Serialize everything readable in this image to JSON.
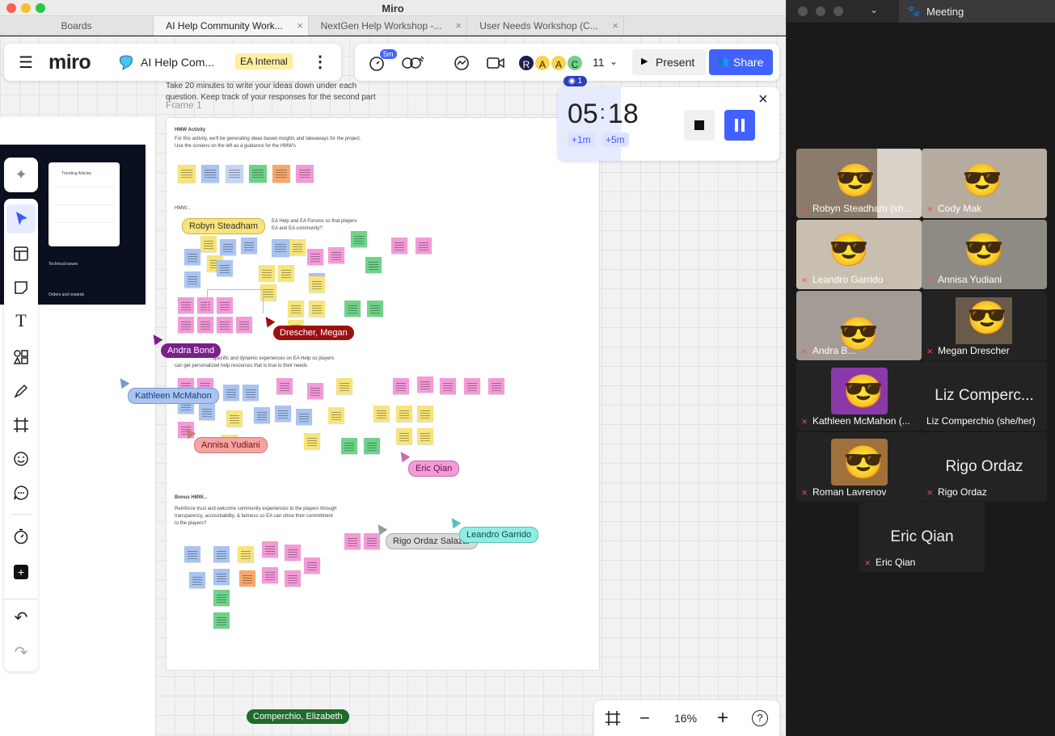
{
  "window": {
    "title": "Miro"
  },
  "tabs": [
    {
      "label": "Boards"
    },
    {
      "label": "AI Help Community Work...",
      "close": "×"
    },
    {
      "label": "NextGen Help Workshop -...",
      "close": "×"
    },
    {
      "label": "User Needs Workshop (C...",
      "close": "×"
    }
  ],
  "toolbar": {
    "menu_icon": "hamburger-icon",
    "logo": "miro",
    "board_name": "AI Help Com...",
    "badge": "EA Internal",
    "more": "⋮",
    "timer_badge": "5m",
    "avatars": [
      "R",
      "A",
      "A",
      "C"
    ],
    "avatar_count": "11",
    "present_label": "Present",
    "share_label": "Share",
    "viewers_count": "1"
  },
  "timer": {
    "minutes": "05",
    "seconds": "18",
    "separator": ":",
    "add1": "+1m",
    "add5": "+5m",
    "close": "×"
  },
  "frame": {
    "label": "Frame 1",
    "intro_line1": "Take 20 minutes to write your ideas down under each",
    "intro_line2": "question. Keep track of your responses for the second part",
    "hmw_title": "HMW Activity",
    "hmw_desc1": "For this activity, we'll be generating ideas based insights and takeaways for the project.",
    "hmw_desc2": "Use the screens on the left as a guidance for the HMW's",
    "q1_label": "HMW...",
    "q1_line1": "EA Help and EA Forums  so that players",
    "q1_line2": "EA and EA community?",
    "q2_line1": "...specific and dynamic experiences on EA Help so players",
    "q2_line2": "can get personalized help resources that is true to their needs",
    "bonus_title": "Bonus HMW...",
    "bonus_line1": "Reinforce trust and welcome community experiences to the players through",
    "bonus_line2": "transparency, accountability, & fairness so EA can show their commitment",
    "bonus_line3": "to the players?"
  },
  "screen_preview": {
    "heading": "Trending Articles",
    "section1": "Technical issues",
    "section2": "Orders and rewards"
  },
  "cursors": [
    {
      "name": "Robyn Steadham",
      "color": "#f7e47a",
      "text": "#333"
    },
    {
      "name": "Drescher, Megan",
      "color": "#9b1111",
      "text": "#fff"
    },
    {
      "name": "Andra Bond",
      "color": "#7b1f8a",
      "text": "#fff"
    },
    {
      "name": "Kathleen McMahon",
      "color": "#a9c4f0",
      "text": "#1a3a7a"
    },
    {
      "name": "Annisa Yudiani",
      "color": "#f5a3a3",
      "text": "#6b1212"
    },
    {
      "name": "Eric Qian",
      "color": "#f39ad8",
      "text": "#6a0f4e"
    },
    {
      "name": "Rigo Ordaz Salazar",
      "color": "#d9d9d9",
      "text": "#333"
    },
    {
      "name": "Leandro Garrido",
      "color": "#8eeee6",
      "text": "#0d4d47"
    },
    {
      "name": "Comperchio, Elizabeth",
      "color": "#1f6b2a",
      "text": "#fff"
    }
  ],
  "zoom": {
    "level": "16%",
    "minus": "−",
    "plus": "+",
    "help": "?"
  },
  "meeting": {
    "title": "Meeting",
    "participants": [
      {
        "name": "Robyn Steadham (sh...",
        "muted": true
      },
      {
        "name": "Cody Mak",
        "muted": true
      },
      {
        "name": "Leandro Garrido",
        "muted": true
      },
      {
        "name": "Annisa Yudiani",
        "muted": true
      },
      {
        "name": "Andra B...",
        "muted": true
      },
      {
        "name": "Megan Drescher",
        "muted": true
      },
      {
        "name": "Kathleen McMahon (...",
        "muted": true
      },
      {
        "name": "Liz Comperchio (she/her)",
        "muted": false,
        "big": "Liz Comperc..."
      },
      {
        "name": "Roman Lavrenov",
        "muted": true
      },
      {
        "name": "Rigo Ordaz",
        "muted": true,
        "big": "Rigo Ordaz"
      },
      {
        "name": "Eric Qian",
        "muted": true,
        "big": "Eric Qian"
      }
    ]
  },
  "colors": {
    "accent": "#4262ff",
    "timer_pause": "#4262ff",
    "mac_red": "#ff5f57",
    "mac_yellow": "#febc2e",
    "mac_green": "#28c840"
  }
}
